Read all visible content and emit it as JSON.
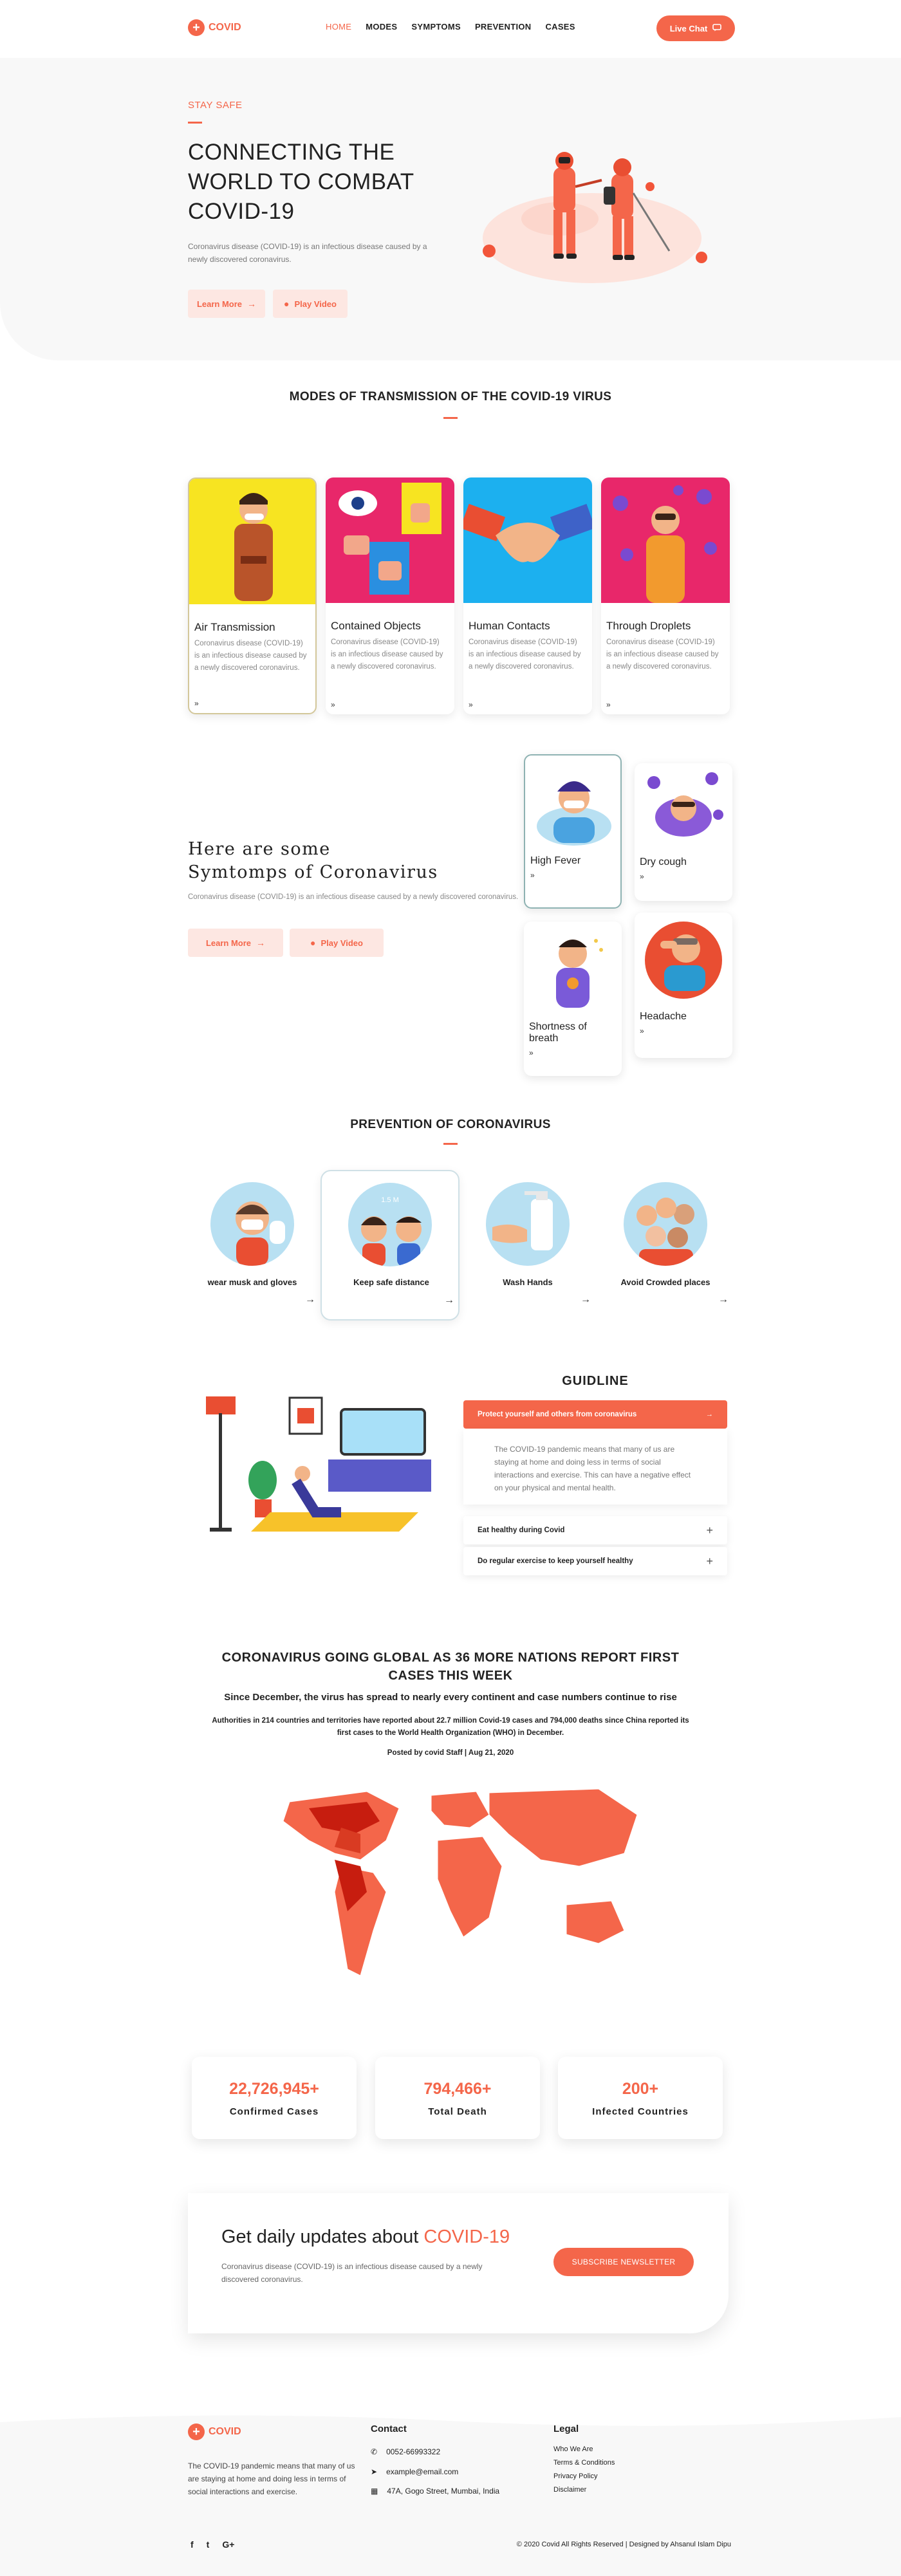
{
  "header": {
    "logo_text": "COVID",
    "nav": [
      "HOME",
      "MODES",
      "SYMPTOMS",
      "PREVENTION",
      "CASES"
    ],
    "live_chat": "Live Chat"
  },
  "hero": {
    "tag": "STAY SAFE",
    "title_lines": [
      "CONNECTING THE",
      "WORLD TO COMBAT",
      "COVID-19"
    ],
    "subtitle": "Coronavirus disease (COVID-19) is an infectious disease caused by a newly discovered coronavirus.",
    "learn_more": "Learn More",
    "play_video": "Play Video"
  },
  "modes": {
    "title": "MODES OF TRANSMISSION OF THE COVID-19 VIRUS",
    "cards": [
      {
        "name": "Air Transmission",
        "text": "Coronavirus disease (COVID-19) is an infectious disease caused by a newly discovered coronavirus."
      },
      {
        "name": "Contained Objects",
        "text": "Coronavirus disease (COVID-19) is an infectious disease caused by a newly discovered coronavirus."
      },
      {
        "name": "Human Contacts",
        "text": "Coronavirus disease (COVID-19) is an infectious disease caused by a newly discovered coronavirus."
      },
      {
        "name": "Through Droplets",
        "text": "Coronavirus disease (COVID-19) is an infectious disease caused by a newly discovered coronavirus."
      }
    ],
    "more_glyph": "»"
  },
  "symptoms": {
    "title_line1": "Here are some",
    "title_line2": "Symtomps of Coronavirus",
    "subtitle": "Coronavirus disease (COVID-19) is an infectious disease caused by a newly discovered coronavirus.",
    "learn_more": "Learn More",
    "play_video": "Play Video",
    "cards": [
      "High Fever",
      "Dry cough",
      "Shortness of breath",
      "Headache"
    ]
  },
  "prevention": {
    "title": "PREVENTION OF CORONAVIRUS",
    "items": [
      "wear musk and gloves",
      "Keep safe distance",
      "Wash Hands",
      "Avoid Crowded places"
    ],
    "distance_label": "1.5 M",
    "arrow": "→"
  },
  "guideline": {
    "title": "GUIDLINE",
    "open_item": "Protect yourself and others from coronavirus",
    "open_text": "The COVID-19 pandemic means that many of us are staying at home and doing less in terms of social interactions and exercise. This can have a negative effect on your physical and mental health.",
    "items": [
      "Eat healthy during Covid",
      "Do regular exercise to keep yourself healthy"
    ]
  },
  "news": {
    "title": "CORONAVIRUS GOING GLOBAL AS 36 MORE NATIONS REPORT FIRST CASES THIS WEEK",
    "subtitle": "Since December, the virus has spread to nearly every continent and case numbers continue to rise",
    "body": "Authorities in 214 countries and territories have reported about 22.7 million Covid-19 cases and 794,000 deaths since China reported its first cases to the World Health Organization (WHO) in December.",
    "meta": "Posted by covid Staff | Aug 21, 2020"
  },
  "stats": [
    {
      "value": "22,726,945+",
      "label": "Confirmed Cases"
    },
    {
      "value": "794,466+",
      "label": "Total Death"
    },
    {
      "value": "200+",
      "label": "Infected Countries"
    }
  ],
  "newsletter": {
    "title_prefix": "Get daily updates about ",
    "title_highlight": "COVID-19",
    "subtitle": "Coronavirus disease (COVID-19) is an infectious disease caused by a newly discovered coronavirus.",
    "button": "SUBSCRIBE NEWSLETTER"
  },
  "footer": {
    "logo_text": "COVID",
    "about": "The COVID-19 pandemic means that many of us are staying at home and doing less in terms of social interactions and exercise.",
    "contact_title": "Contact",
    "phone": "0052-66993322",
    "email": "example@email.com",
    "address": "47A, Gogo Street, Mumbai, India",
    "legal_title": "Legal",
    "legal_links": [
      "Who We Are",
      "Terms & Conditions",
      "Privacy Policy",
      "Disclaimer"
    ],
    "copyright": "© 2020 Covid All Rights Reserved | Designed by Ahsanul Islam Dipu",
    "social": [
      "f",
      "t",
      "G+"
    ]
  },
  "colors": {
    "accent": "#f4664a",
    "soft": "#fde7e2",
    "light_bg": "#f8f8f8"
  }
}
